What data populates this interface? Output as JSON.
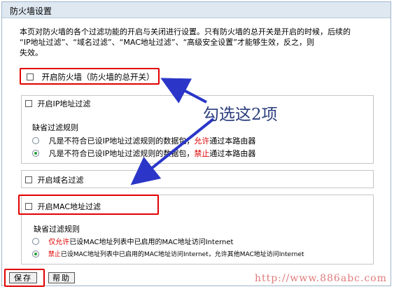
{
  "header": {
    "title": "防火墙设置"
  },
  "description": {
    "line1": "本页对防火墙的各个过滤功能的开启与关闭进行设置。只有防火墙的总开关是开启的时候，后续的",
    "line2": "“IP地址过滤”、“域名过滤”、“MAC地址过滤”、“高级安全设置”才能够生效，反之，则",
    "line3": "失效。"
  },
  "master_switch": {
    "label": "开启防火墙（防火墙的总开关）",
    "checked": false
  },
  "ip_filter": {
    "label": "开启IP地址过滤",
    "checked": false,
    "rule_title": "缺省过滤规则",
    "options": [
      {
        "pre": "凡是不符合已设IP地址过滤规则的数据包，",
        "hl": "允许",
        "post": "通过本路由器",
        "selected": false
      },
      {
        "pre": "凡是不符合已设IP地址过滤规则的数据包，",
        "hl": "禁止",
        "post": "通过本路由器",
        "selected": true
      }
    ]
  },
  "domain_filter": {
    "label": "开启域名过滤",
    "checked": false
  },
  "mac_filter": {
    "label": "开启MAC地址过滤",
    "checked": false,
    "rule_title": "缺省过滤规则",
    "options": [
      {
        "hl": "仅允许",
        "post": "已设MAC地址列表中已启用的MAC地址访问Internet",
        "selected": false
      },
      {
        "hl": "禁止",
        "post": "已设MAC地址列表中已启用的MAC地址访问Internet，允许其他MAC地址访问Internet",
        "selected": true
      }
    ]
  },
  "buttons": {
    "save": "保存",
    "help": "帮助"
  },
  "annotation": "勾选这2项",
  "watermark": "http://www.886abc.com",
  "colors": {
    "highlight": "#e20000",
    "arrow": "#2b36c8",
    "header_bg": "#dfe8f1",
    "watermark": "#e07a7a"
  }
}
